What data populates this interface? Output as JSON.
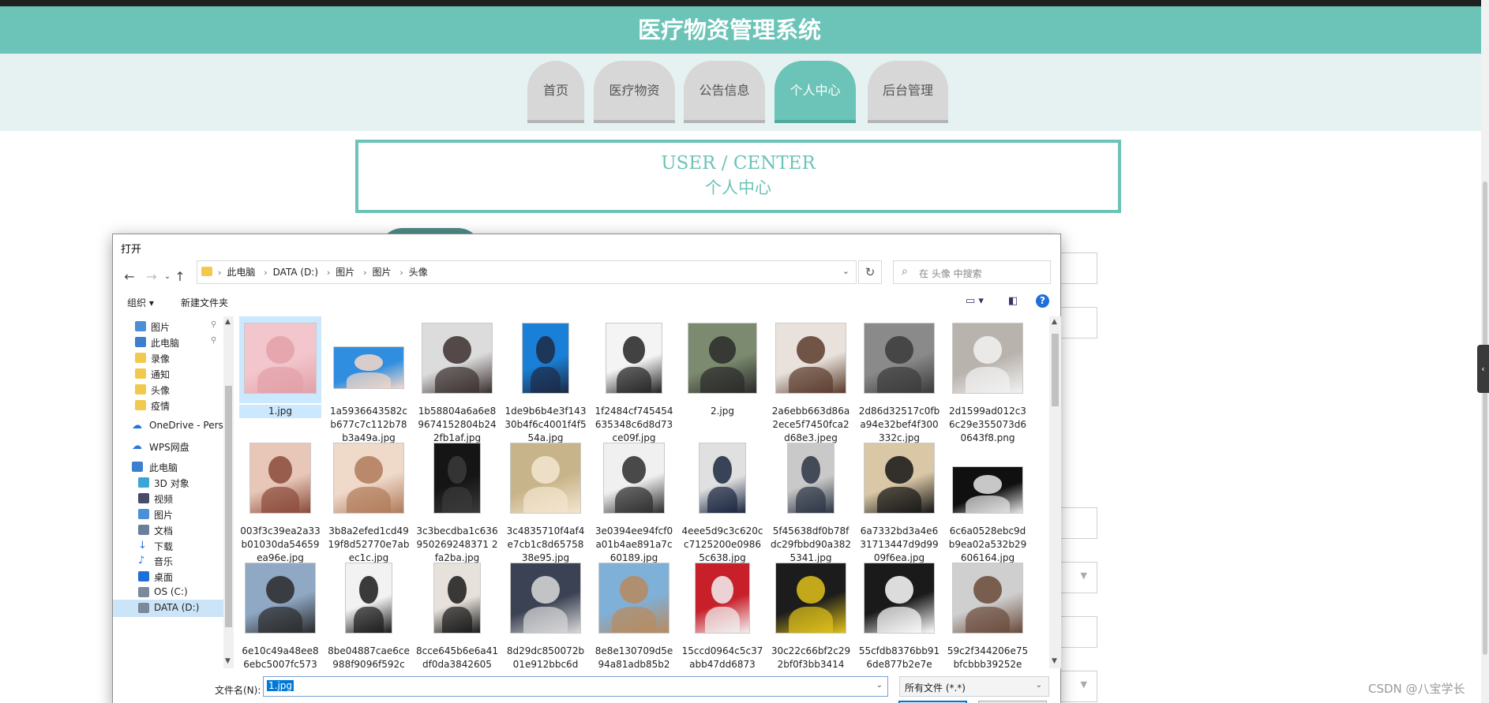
{
  "site": {
    "title": "医疗物资管理系统",
    "nav": [
      {
        "label": "首页",
        "active": false
      },
      {
        "label": "医疗物资",
        "active": false
      },
      {
        "label": "公告信息",
        "active": false
      },
      {
        "label": "个人中心",
        "active": true
      },
      {
        "label": "后台管理",
        "active": false
      }
    ],
    "center_en": "USER / CENTER",
    "center_cn": "个人中心",
    "accent": "#6cc3b7",
    "watermark": "CSDN @八宝学长"
  },
  "dialog": {
    "title": "打开",
    "breadcrumbs": [
      "此电脑",
      "DATA (D:)",
      "图片",
      "图片",
      "头像"
    ],
    "search_placeholder": "在 头像 中搜索",
    "toolbar": {
      "organize": "组织 ▾",
      "new_folder": "新建文件夹"
    },
    "nav_items": [
      {
        "label": "图片",
        "icon": "pictures-icon",
        "pinned": true
      },
      {
        "label": "此电脑",
        "icon": "computer-icon",
        "pinned": true
      },
      {
        "label": "录像",
        "icon": "folder-icon",
        "pinned": false
      },
      {
        "label": "通知",
        "icon": "folder-icon",
        "pinned": false
      },
      {
        "label": "头像",
        "icon": "folder-icon",
        "pinned": false
      },
      {
        "label": "疫情",
        "icon": "folder-icon",
        "pinned": false
      },
      {
        "label": "OneDrive - Perso",
        "icon": "onedrive-icon",
        "pinned": false
      },
      {
        "label": "WPS网盘",
        "icon": "wps-cloud-icon",
        "pinned": false
      },
      {
        "label": "此电脑",
        "icon": "computer-icon",
        "pinned": false
      },
      {
        "label": "3D 对象",
        "icon": "3d-objects-icon",
        "pinned": false
      },
      {
        "label": "视频",
        "icon": "videos-icon",
        "pinned": false
      },
      {
        "label": "图片",
        "icon": "pictures-icon",
        "pinned": false
      },
      {
        "label": "文档",
        "icon": "documents-icon",
        "pinned": false
      },
      {
        "label": "下载",
        "icon": "downloads-icon",
        "pinned": false
      },
      {
        "label": "音乐",
        "icon": "music-icon",
        "pinned": false
      },
      {
        "label": "桌面",
        "icon": "desktop-icon",
        "pinned": false
      },
      {
        "label": "OS (C:)",
        "icon": "drive-icon",
        "pinned": false
      },
      {
        "label": "DATA (D:)",
        "icon": "drive-icon",
        "pinned": false
      }
    ],
    "files": [
      {
        "name": "1.jpg",
        "bg": "#f2c6cc",
        "fg": "#e3a0a8",
        "selected": true
      },
      {
        "name": "1a5936643582cb677c7c112b78b3a49a.jpg",
        "bg": "#2f8ee0",
        "fg": "#f5d8c8",
        "selected": false
      },
      {
        "name": "1b58804a6a6e89674152804b242fb1af.jpg",
        "bg": "#dcdcdc",
        "fg": "#3b2f2f",
        "selected": false
      },
      {
        "name": "1de9b6b4e3f14330b4f6c4001f4f554a.jpg",
        "bg": "#1a7fd6",
        "fg": "#1d2a44",
        "selected": false
      },
      {
        "name": "1f2484cf745454635348c6d8d73ce09f.jpg",
        "bg": "#f4f4f4",
        "fg": "#222222",
        "selected": false
      },
      {
        "name": "2.jpg",
        "bg": "#7c8b6f",
        "fg": "#2a2a2a",
        "selected": false
      },
      {
        "name": "2a6ebb663d86a2ece5f7450fca2d68e3.jpeg",
        "bg": "#e9e2dc",
        "fg": "#5a3b2c",
        "selected": false
      },
      {
        "name": "2d86d32517c0fba94e32bef4f300332c.jpg",
        "bg": "#8a8a8a",
        "fg": "#3a3a3a",
        "selected": false
      },
      {
        "name": "2d1599ad012c36c29e355073d60643f8.png",
        "bg": "#b9b3ad",
        "fg": "#f2f2f2",
        "selected": false
      },
      {
        "name": "003f3c39ea2a33b01030da54659ea96e.jpg",
        "bg": "#e8c7b8",
        "fg": "#8a4a3a",
        "selected": false
      },
      {
        "name": "3b8a2efed1cd4919f8d52770e7abec1c.jpg",
        "bg": "#efd9c9",
        "fg": "#b07a5a",
        "selected": false
      },
      {
        "name": "3c3becdba1c636950269248371 2fa2ba.jpg",
        "bg": "#151515",
        "fg": "#3a3a3a",
        "selected": false
      },
      {
        "name": "3c4835710f4af4e7cb1c8d6575838e95.jpg",
        "bg": "#c8b48a",
        "fg": "#f3e6cf",
        "selected": false
      },
      {
        "name": "3e0394ee94fcf0a01b4ae891a7c60189.jpg",
        "bg": "#f0f0f0",
        "fg": "#2b2b2b",
        "selected": false
      },
      {
        "name": "4eee5d9c3c620cc7125200e09865c638.jpg",
        "bg": "#e0e0e0",
        "fg": "#1b2740",
        "selected": false
      },
      {
        "name": "5f45638df0b78fdc29fbbd90a3825341.jpg",
        "bg": "#c9c9c9",
        "fg": "#2c3444",
        "selected": false
      },
      {
        "name": "6a7332bd3a4e631713447d9d9909f6ea.jpg",
        "bg": "#d9c7a6",
        "fg": "#151515",
        "selected": false
      },
      {
        "name": "6c6a0528ebc9db9ea02a532b29606164.jpg",
        "bg": "#101010",
        "fg": "#e8e8e8",
        "selected": false
      },
      {
        "name": "6e10c49a48ee86ebc5007fc573",
        "bg": "#8fa8c4",
        "fg": "#2a2a2a",
        "selected": false
      },
      {
        "name": "8be04887cae6ce988f9096f592c",
        "bg": "#f2f2f2",
        "fg": "#1a1a1a",
        "selected": false
      },
      {
        "name": "8cce645b6e6a41df0da3842605",
        "bg": "#e6e1da",
        "fg": "#1a1a1a",
        "selected": false
      },
      {
        "name": "8d29dc850072b01e912bbc6d",
        "bg": "#3b4254",
        "fg": "#d9d9d9",
        "selected": false
      },
      {
        "name": "8e8e130709d5e94a81adb85b2",
        "bg": "#7fb0d8",
        "fg": "#b98a5e",
        "selected": false
      },
      {
        "name": "15ccd0964c5c37abb47dd6873",
        "bg": "#c8202a",
        "fg": "#f2f2f2",
        "selected": false
      },
      {
        "name": "30c22c66bf2c292bf0f3bb3414",
        "bg": "#1c1c1c",
        "fg": "#e0c21a",
        "selected": false
      },
      {
        "name": "55cfdb8376bb916de877b2e7e",
        "bg": "#1a1a1a",
        "fg": "#ffffff",
        "selected": false
      },
      {
        "name": "59c2f344206e75bfcbbb39252e",
        "bg": "#cfcfcf",
        "fg": "#6a4a3a",
        "selected": false
      }
    ],
    "filename_label": "文件名(N):",
    "filename_value": "1.jpg",
    "filetype_value": "所有文件 (*.*)"
  }
}
